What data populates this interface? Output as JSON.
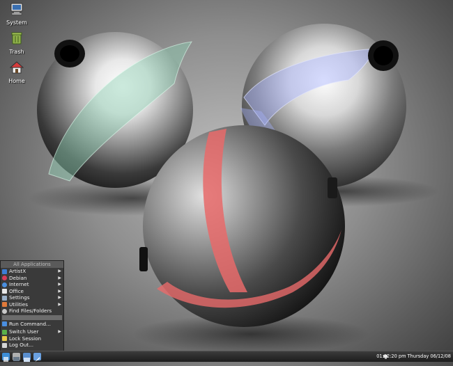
{
  "desktop": {
    "icons": [
      {
        "label": "System",
        "icon": "computer-icon"
      },
      {
        "label": "Trash",
        "icon": "trash-icon"
      },
      {
        "label": "Home",
        "icon": "home-icon"
      }
    ]
  },
  "menu": {
    "header": "All Applications",
    "items": [
      {
        "label": "ArtistX",
        "icon": "artistx-icon",
        "submenu": true,
        "color": "#3c7ed6"
      },
      {
        "label": "Debian",
        "icon": "debian-icon",
        "submenu": true,
        "color": "#d63c5a"
      },
      {
        "label": "Internet",
        "icon": "globe-icon",
        "submenu": true,
        "color": "#4a8fe0"
      },
      {
        "label": "Office",
        "icon": "document-icon",
        "submenu": true,
        "color": "#e8e8e8"
      },
      {
        "label": "Settings",
        "icon": "tools-icon",
        "submenu": true,
        "color": "#9ab0c8"
      },
      {
        "label": "Utilities",
        "icon": "utilities-icon",
        "submenu": true,
        "color": "#e07a3a"
      },
      {
        "label": "Find Files/Folders",
        "icon": "search-icon",
        "submenu": false,
        "color": "#c8c8c8"
      }
    ],
    "actions": [
      {
        "label": "Run Command...",
        "icon": "run-icon",
        "color": "#4a8fe0"
      },
      {
        "label": "Switch User",
        "icon": "switch-user-icon",
        "color": "#5ab04a"
      },
      {
        "label": "Lock Session",
        "icon": "lock-icon",
        "color": "#e8c84a"
      },
      {
        "label": "Log Out...",
        "icon": "logout-icon",
        "color": "#d6d6d6"
      }
    ]
  },
  "taskbar": {
    "clock": "01:32:20 pm  Thursday  06/12/08",
    "colors": {
      "start": "#3c8ed6",
      "desktop": "#b0b0b0",
      "files": "#5a8fd0",
      "tool": "#6aa0e0"
    }
  }
}
